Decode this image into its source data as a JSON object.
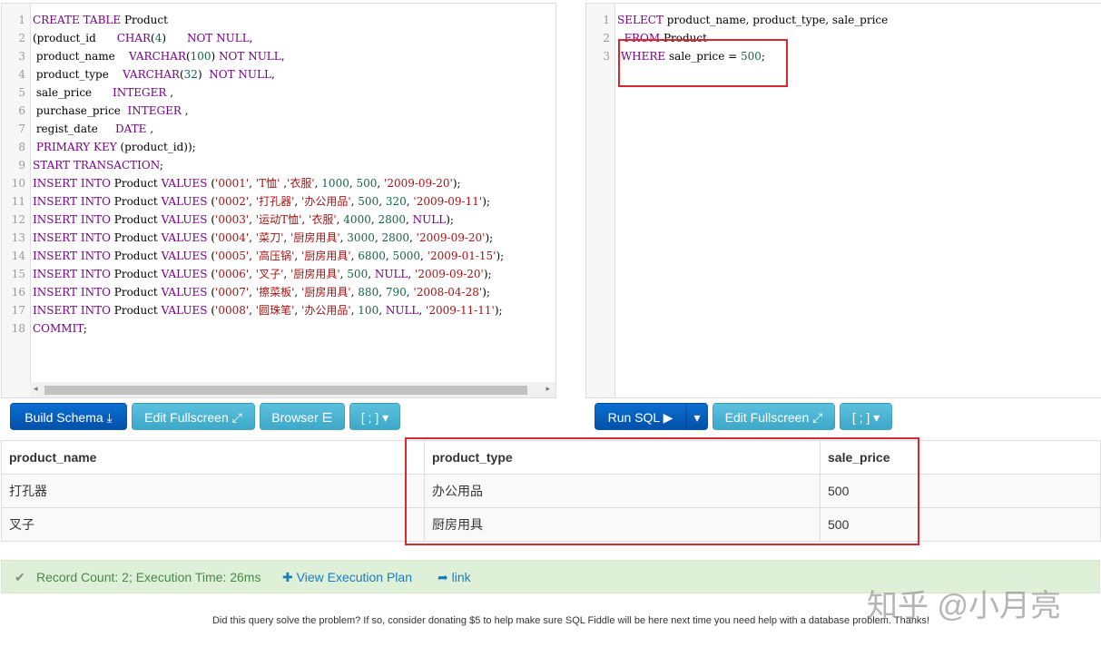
{
  "schema_editor": {
    "lines": [
      [
        [
          "kw",
          "CREATE TABLE "
        ],
        [
          "code",
          "Product"
        ]
      ],
      [
        [
          "code",
          "(product_id      "
        ],
        [
          "kw",
          "CHAR"
        ],
        [
          "code",
          "("
        ],
        [
          "nm",
          "4"
        ],
        [
          "code",
          ")      "
        ],
        [
          "kw",
          "NOT NULL"
        ],
        [
          "code",
          ","
        ]
      ],
      [
        [
          "code",
          " product_name    "
        ],
        [
          "kw",
          "VARCHAR"
        ],
        [
          "code",
          "("
        ],
        [
          "nm",
          "100"
        ],
        [
          "code",
          ") "
        ],
        [
          "kw",
          "NOT NULL"
        ],
        [
          "code",
          ","
        ]
      ],
      [
        [
          "code",
          " product_type    "
        ],
        [
          "kw",
          "VARCHAR"
        ],
        [
          "code",
          "("
        ],
        [
          "nm",
          "32"
        ],
        [
          "code",
          ")  "
        ],
        [
          "kw",
          "NOT NULL"
        ],
        [
          "code",
          ","
        ]
      ],
      [
        [
          "code",
          " sale_price      "
        ],
        [
          "kw",
          "INTEGER"
        ],
        [
          "code",
          " ,"
        ]
      ],
      [
        [
          "code",
          " purchase_price  "
        ],
        [
          "kw",
          "INTEGER"
        ],
        [
          "code",
          " ,"
        ]
      ],
      [
        [
          "code",
          " regist_date     "
        ],
        [
          "kw",
          "DATE"
        ],
        [
          "code",
          " ,"
        ]
      ],
      [
        [
          "code",
          " "
        ],
        [
          "kw",
          "PRIMARY KEY"
        ],
        [
          "code",
          " (product_id));"
        ]
      ],
      [
        [
          "kw",
          "START TRANSACTION"
        ],
        [
          "code",
          ";"
        ]
      ],
      [
        [
          "kw",
          "INSERT INTO "
        ],
        [
          "code",
          "Product "
        ],
        [
          "kw",
          "VALUES"
        ],
        [
          "code",
          " ("
        ],
        [
          "str",
          "'0001'"
        ],
        [
          "code",
          ", "
        ],
        [
          "str",
          "'T恤'"
        ],
        [
          "code",
          " ,"
        ],
        [
          "str",
          "'衣服'"
        ],
        [
          "code",
          ", "
        ],
        [
          "nm",
          "1000"
        ],
        [
          "code",
          ", "
        ],
        [
          "nm",
          "500"
        ],
        [
          "code",
          ", "
        ],
        [
          "str",
          "'2009-09-20'"
        ],
        [
          "code",
          ");"
        ]
      ],
      [
        [
          "kw",
          "INSERT INTO "
        ],
        [
          "code",
          "Product "
        ],
        [
          "kw",
          "VALUES"
        ],
        [
          "code",
          " ("
        ],
        [
          "str",
          "'0002'"
        ],
        [
          "code",
          ", "
        ],
        [
          "str",
          "'打孔器'"
        ],
        [
          "code",
          ", "
        ],
        [
          "str",
          "'办公用品'"
        ],
        [
          "code",
          ", "
        ],
        [
          "nm",
          "500"
        ],
        [
          "code",
          ", "
        ],
        [
          "nm",
          "320"
        ],
        [
          "code",
          ", "
        ],
        [
          "str",
          "'2009-09-11'"
        ],
        [
          "code",
          ");"
        ]
      ],
      [
        [
          "kw",
          "INSERT INTO "
        ],
        [
          "code",
          "Product "
        ],
        [
          "kw",
          "VALUES"
        ],
        [
          "code",
          " ("
        ],
        [
          "str",
          "'0003'"
        ],
        [
          "code",
          ", "
        ],
        [
          "str",
          "'运动T恤'"
        ],
        [
          "code",
          ", "
        ],
        [
          "str",
          "'衣服'"
        ],
        [
          "code",
          ", "
        ],
        [
          "nm",
          "4000"
        ],
        [
          "code",
          ", "
        ],
        [
          "nm",
          "2800"
        ],
        [
          "code",
          ", "
        ],
        [
          "kw",
          "NULL"
        ],
        [
          "code",
          ");"
        ]
      ],
      [
        [
          "kw",
          "INSERT INTO "
        ],
        [
          "code",
          "Product "
        ],
        [
          "kw",
          "VALUES"
        ],
        [
          "code",
          " ("
        ],
        [
          "str",
          "'0004'"
        ],
        [
          "code",
          ", "
        ],
        [
          "str",
          "'菜刀'"
        ],
        [
          "code",
          ", "
        ],
        [
          "str",
          "'厨房用具'"
        ],
        [
          "code",
          ", "
        ],
        [
          "nm",
          "3000"
        ],
        [
          "code",
          ", "
        ],
        [
          "nm",
          "2800"
        ],
        [
          "code",
          ", "
        ],
        [
          "str",
          "'2009-09-20'"
        ],
        [
          "code",
          ");"
        ]
      ],
      [
        [
          "kw",
          "INSERT INTO "
        ],
        [
          "code",
          "Product "
        ],
        [
          "kw",
          "VALUES"
        ],
        [
          "code",
          " ("
        ],
        [
          "str",
          "'0005'"
        ],
        [
          "code",
          ", "
        ],
        [
          "str",
          "'高压锅'"
        ],
        [
          "code",
          ", "
        ],
        [
          "str",
          "'厨房用具'"
        ],
        [
          "code",
          ", "
        ],
        [
          "nm",
          "6800"
        ],
        [
          "code",
          ", "
        ],
        [
          "nm",
          "5000"
        ],
        [
          "code",
          ", "
        ],
        [
          "str",
          "'2009-01-15'"
        ],
        [
          "code",
          ");"
        ]
      ],
      [
        [
          "kw",
          "INSERT INTO "
        ],
        [
          "code",
          "Product "
        ],
        [
          "kw",
          "VALUES"
        ],
        [
          "code",
          " ("
        ],
        [
          "str",
          "'0006'"
        ],
        [
          "code",
          ", "
        ],
        [
          "str",
          "'叉子'"
        ],
        [
          "code",
          ", "
        ],
        [
          "str",
          "'厨房用具'"
        ],
        [
          "code",
          ", "
        ],
        [
          "nm",
          "500"
        ],
        [
          "code",
          ", "
        ],
        [
          "kw",
          "NULL"
        ],
        [
          "code",
          ", "
        ],
        [
          "str",
          "'2009-09-20'"
        ],
        [
          "code",
          ");"
        ]
      ],
      [
        [
          "kw",
          "INSERT INTO "
        ],
        [
          "code",
          "Product "
        ],
        [
          "kw",
          "VALUES"
        ],
        [
          "code",
          " ("
        ],
        [
          "str",
          "'0007'"
        ],
        [
          "code",
          ", "
        ],
        [
          "str",
          "'擦菜板'"
        ],
        [
          "code",
          ", "
        ],
        [
          "str",
          "'厨房用具'"
        ],
        [
          "code",
          ", "
        ],
        [
          "nm",
          "880"
        ],
        [
          "code",
          ", "
        ],
        [
          "nm",
          "790"
        ],
        [
          "code",
          ", "
        ],
        [
          "str",
          "'2008-04-28'"
        ],
        [
          "code",
          ");"
        ]
      ],
      [
        [
          "kw",
          "INSERT INTO "
        ],
        [
          "code",
          "Product "
        ],
        [
          "kw",
          "VALUES"
        ],
        [
          "code",
          " ("
        ],
        [
          "str",
          "'0008'"
        ],
        [
          "code",
          ", "
        ],
        [
          "str",
          "'圆珠笔'"
        ],
        [
          "code",
          ", "
        ],
        [
          "str",
          "'办公用品'"
        ],
        [
          "code",
          ", "
        ],
        [
          "nm",
          "100"
        ],
        [
          "code",
          ", "
        ],
        [
          "kw",
          "NULL"
        ],
        [
          "code",
          ", "
        ],
        [
          "str",
          "'2009-11-11'"
        ],
        [
          "code",
          ");"
        ]
      ],
      [
        [
          "kw",
          "COMMIT"
        ],
        [
          "code",
          ";"
        ]
      ]
    ]
  },
  "query_editor": {
    "lines": [
      [
        [
          "kw",
          "SELECT"
        ],
        [
          "code",
          " product_name, product_type, sale_price"
        ]
      ],
      [
        [
          "code",
          "  "
        ],
        [
          "kw",
          "FROM"
        ],
        [
          "code",
          " Product"
        ]
      ],
      [
        [
          "code",
          " "
        ],
        [
          "kw",
          "WHERE"
        ],
        [
          "code",
          " sale_price = "
        ],
        [
          "nm",
          "500"
        ],
        [
          "code",
          ";"
        ]
      ]
    ]
  },
  "buttons": {
    "build_schema": "Build Schema ⤓",
    "edit_fullscreen": "Edit Fullscreen ⤢",
    "browser": "Browser ⋿",
    "delimiter": "[ ; ] ▾",
    "run_sql": "Run SQL ▶",
    "run_dropdown": "▾"
  },
  "results": {
    "columns": [
      "product_name",
      "product_type",
      "sale_price"
    ],
    "rows": [
      [
        "打孔器",
        "办公用品",
        "500"
      ],
      [
        "叉子",
        "厨房用具",
        "500"
      ]
    ]
  },
  "status": {
    "icon": "✔",
    "record": "Record Count: 2; Execution Time: 26ms",
    "plan": "✚  View Execution Plan",
    "link": "➦  link"
  },
  "footer": "Did this query solve the problem? If so, consider donating $5 to help make sure SQL Fiddle will be here next time you need help with a database problem. Thanks!",
  "watermark": "知乎 @小月亮"
}
